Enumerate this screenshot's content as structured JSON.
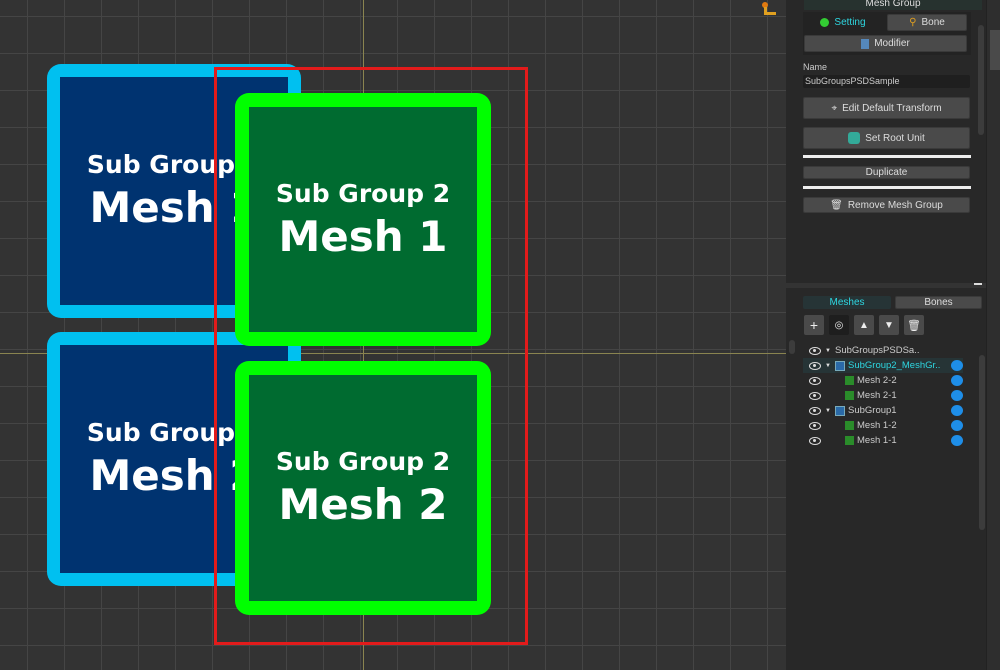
{
  "canvas": {
    "cards": [
      {
        "line1": "Sub Group 1",
        "line2": "Mesh 1",
        "color": "blue"
      },
      {
        "line1": "Sub Group 1",
        "line2": "Mesh 2",
        "color": "blue"
      },
      {
        "line1": "Sub Group 2",
        "line2": "Mesh 1",
        "color": "green"
      },
      {
        "line1": "Sub Group 2",
        "line2": "Mesh 2",
        "color": "green"
      }
    ],
    "selection_color": "#e21b1b"
  },
  "panel": {
    "title": "Mesh Group",
    "tabs": {
      "setting": "Setting",
      "bone": "Bone",
      "modifier": "Modifier"
    },
    "name_label": "Name",
    "name_value": "SubGroupsPSDSample",
    "buttons": {
      "edit_transform": "Edit Default Transform",
      "set_root": "Set Root Unit",
      "duplicate": "Duplicate",
      "remove": "Remove Mesh Group"
    },
    "list_tabs": {
      "meshes": "Meshes",
      "bones": "Bones"
    },
    "tree": [
      {
        "label": "SubGroupsPSDSa..",
        "type": "root"
      },
      {
        "label": "SubGroup2_MeshGr..",
        "type": "group",
        "active": true
      },
      {
        "label": "Mesh 2-2",
        "type": "mesh"
      },
      {
        "label": "Mesh 2-1",
        "type": "mesh"
      },
      {
        "label": "SubGroup1",
        "type": "group"
      },
      {
        "label": "Mesh 1-2",
        "type": "mesh"
      },
      {
        "label": "Mesh 1-1",
        "type": "mesh"
      }
    ],
    "accent": "#2ed6e0"
  }
}
